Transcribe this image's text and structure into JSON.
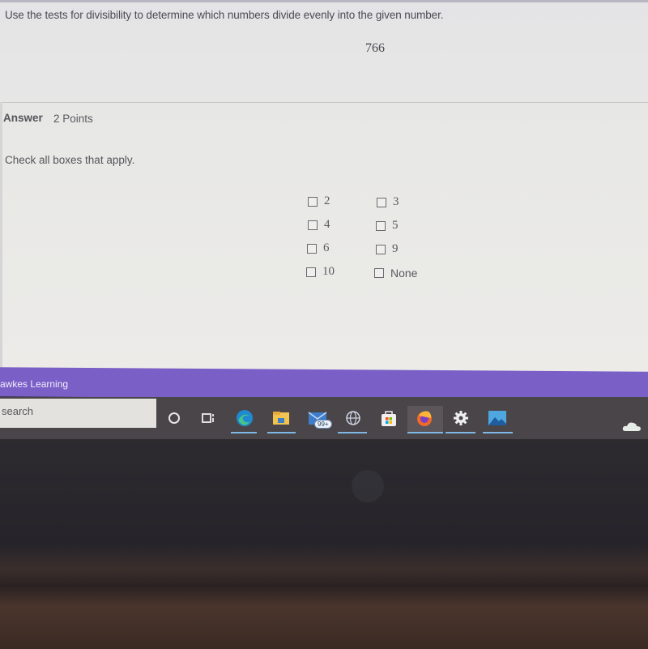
{
  "question": {
    "prompt": "Use the tests for divisibility to determine which numbers divide evenly into the given number.",
    "given_number": "766"
  },
  "answer": {
    "label": "Answer",
    "points": "2 Points",
    "instruction": "Check all boxes that apply.",
    "options": [
      {
        "label": "2",
        "checked": false
      },
      {
        "label": "3",
        "checked": false
      },
      {
        "label": "4",
        "checked": false
      },
      {
        "label": "5",
        "checked": false
      },
      {
        "label": "6",
        "checked": false
      },
      {
        "label": "9",
        "checked": false
      },
      {
        "label": "10",
        "checked": false
      },
      {
        "label": "None",
        "checked": false
      }
    ]
  },
  "window": {
    "app_title": "awkes Learning",
    "accent_color": "#7a5fc7"
  },
  "taskbar": {
    "search_placeholder": "search",
    "mail_badge": "99+",
    "icons": [
      "cortana-icon",
      "task-view-icon",
      "edge-icon",
      "file-explorer-icon",
      "mail-icon",
      "globe-icon",
      "store-icon",
      "firefox-icon",
      "settings-icon",
      "photos-icon",
      "onedrive-icon"
    ]
  }
}
